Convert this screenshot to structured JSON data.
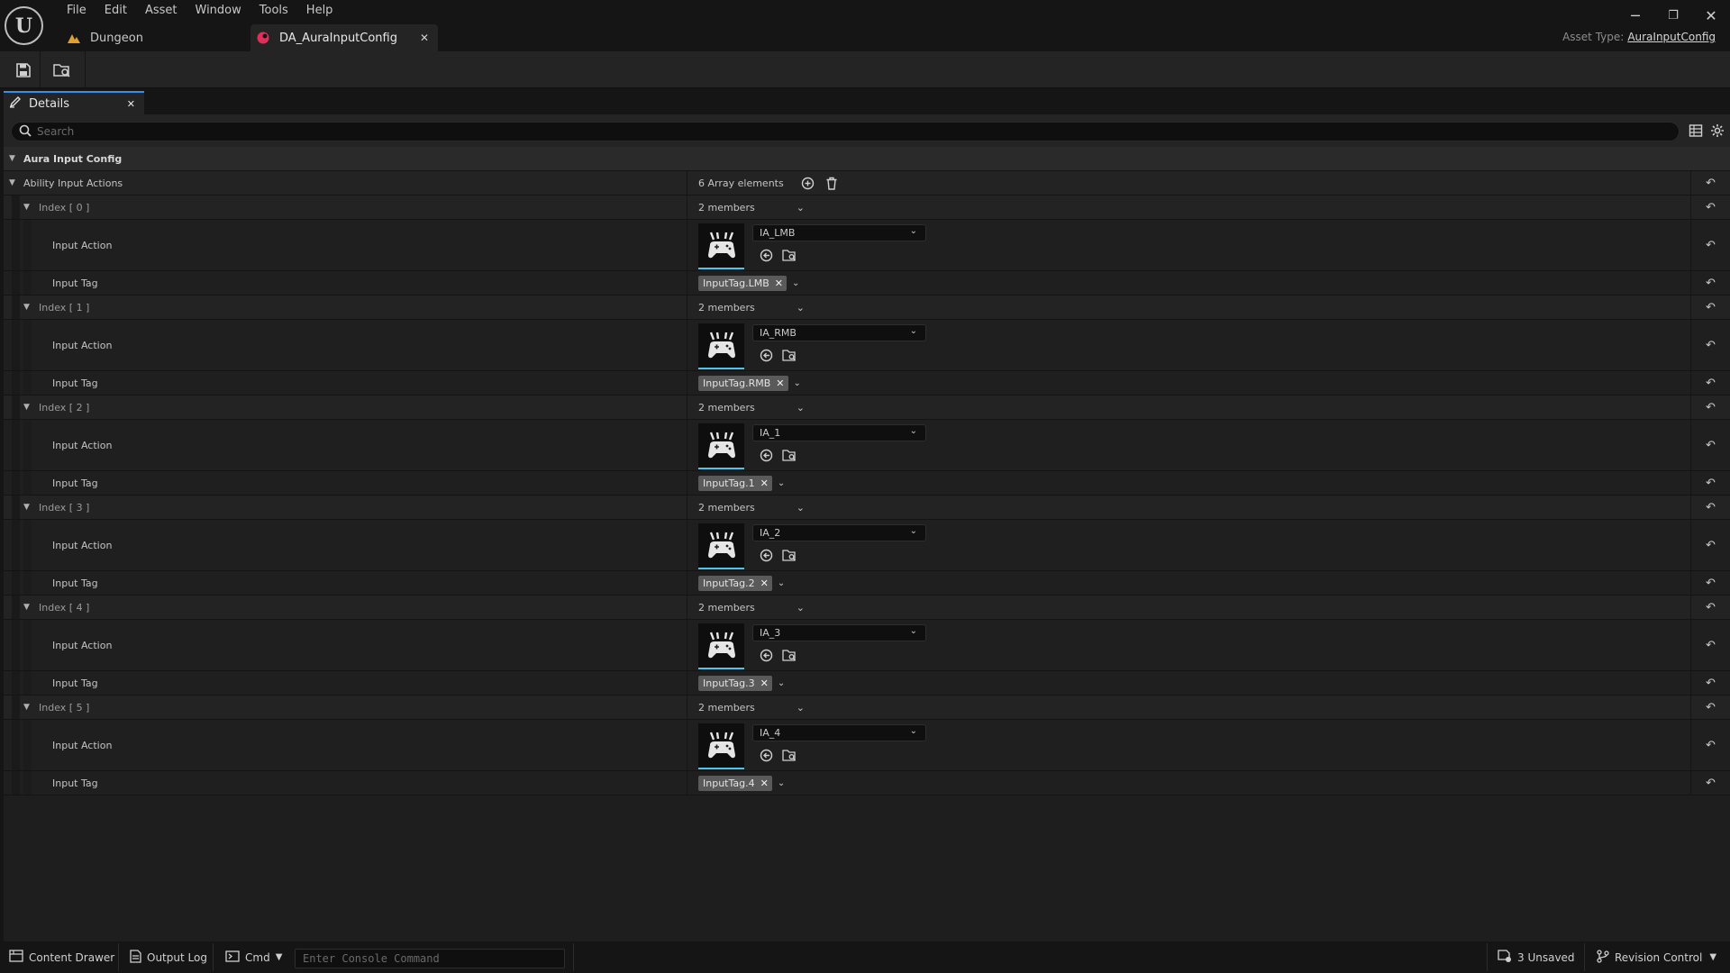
{
  "menu": [
    "File",
    "Edit",
    "Asset",
    "Window",
    "Tools",
    "Help"
  ],
  "tabs": [
    {
      "label": "Dungeon",
      "icon": "level-icon"
    },
    {
      "label": "DA_AuraInputConfig",
      "icon": "data-asset-icon",
      "active": true,
      "close": "✕"
    }
  ],
  "asset_type": {
    "label": "Asset Type:",
    "value": "AuraInputConfig"
  },
  "window_controls": {
    "minimize": "─",
    "restore": "❐",
    "close": "✕"
  },
  "details": {
    "tab_label": "Details",
    "tab_close": "✕",
    "search_placeholder": "Search",
    "category": "Aura Input Config",
    "property": "Ability Input Actions",
    "array_count": "6 Array elements",
    "member_label": "Input Action",
    "tag_label": "Input Tag",
    "entries": [
      {
        "index": "Index [ 0 ]",
        "members": "2 members",
        "action": "IA_LMB",
        "tag": "InputTag.LMB"
      },
      {
        "index": "Index [ 1 ]",
        "members": "2 members",
        "action": "IA_RMB",
        "tag": "InputTag.RMB"
      },
      {
        "index": "Index [ 2 ]",
        "members": "2 members",
        "action": "IA_1",
        "tag": "InputTag.1"
      },
      {
        "index": "Index [ 3 ]",
        "members": "2 members",
        "action": "IA_2",
        "tag": "InputTag.2"
      },
      {
        "index": "Index [ 4 ]",
        "members": "2 members",
        "action": "IA_3",
        "tag": "InputTag.3"
      },
      {
        "index": "Index [ 5 ]",
        "members": "2 members",
        "action": "IA_4",
        "tag": "InputTag.4"
      }
    ]
  },
  "statusbar": {
    "content_drawer": "Content Drawer",
    "output_log": "Output Log",
    "cmd": "Cmd",
    "console_placeholder": "Enter Console Command",
    "unsaved": "3 Unsaved",
    "revision_control": "Revision Control"
  },
  "colors": {
    "accent": "#3b8ee8",
    "thumb_underline": "#4fc4ea",
    "tag_bg": "#5a5a5a"
  }
}
